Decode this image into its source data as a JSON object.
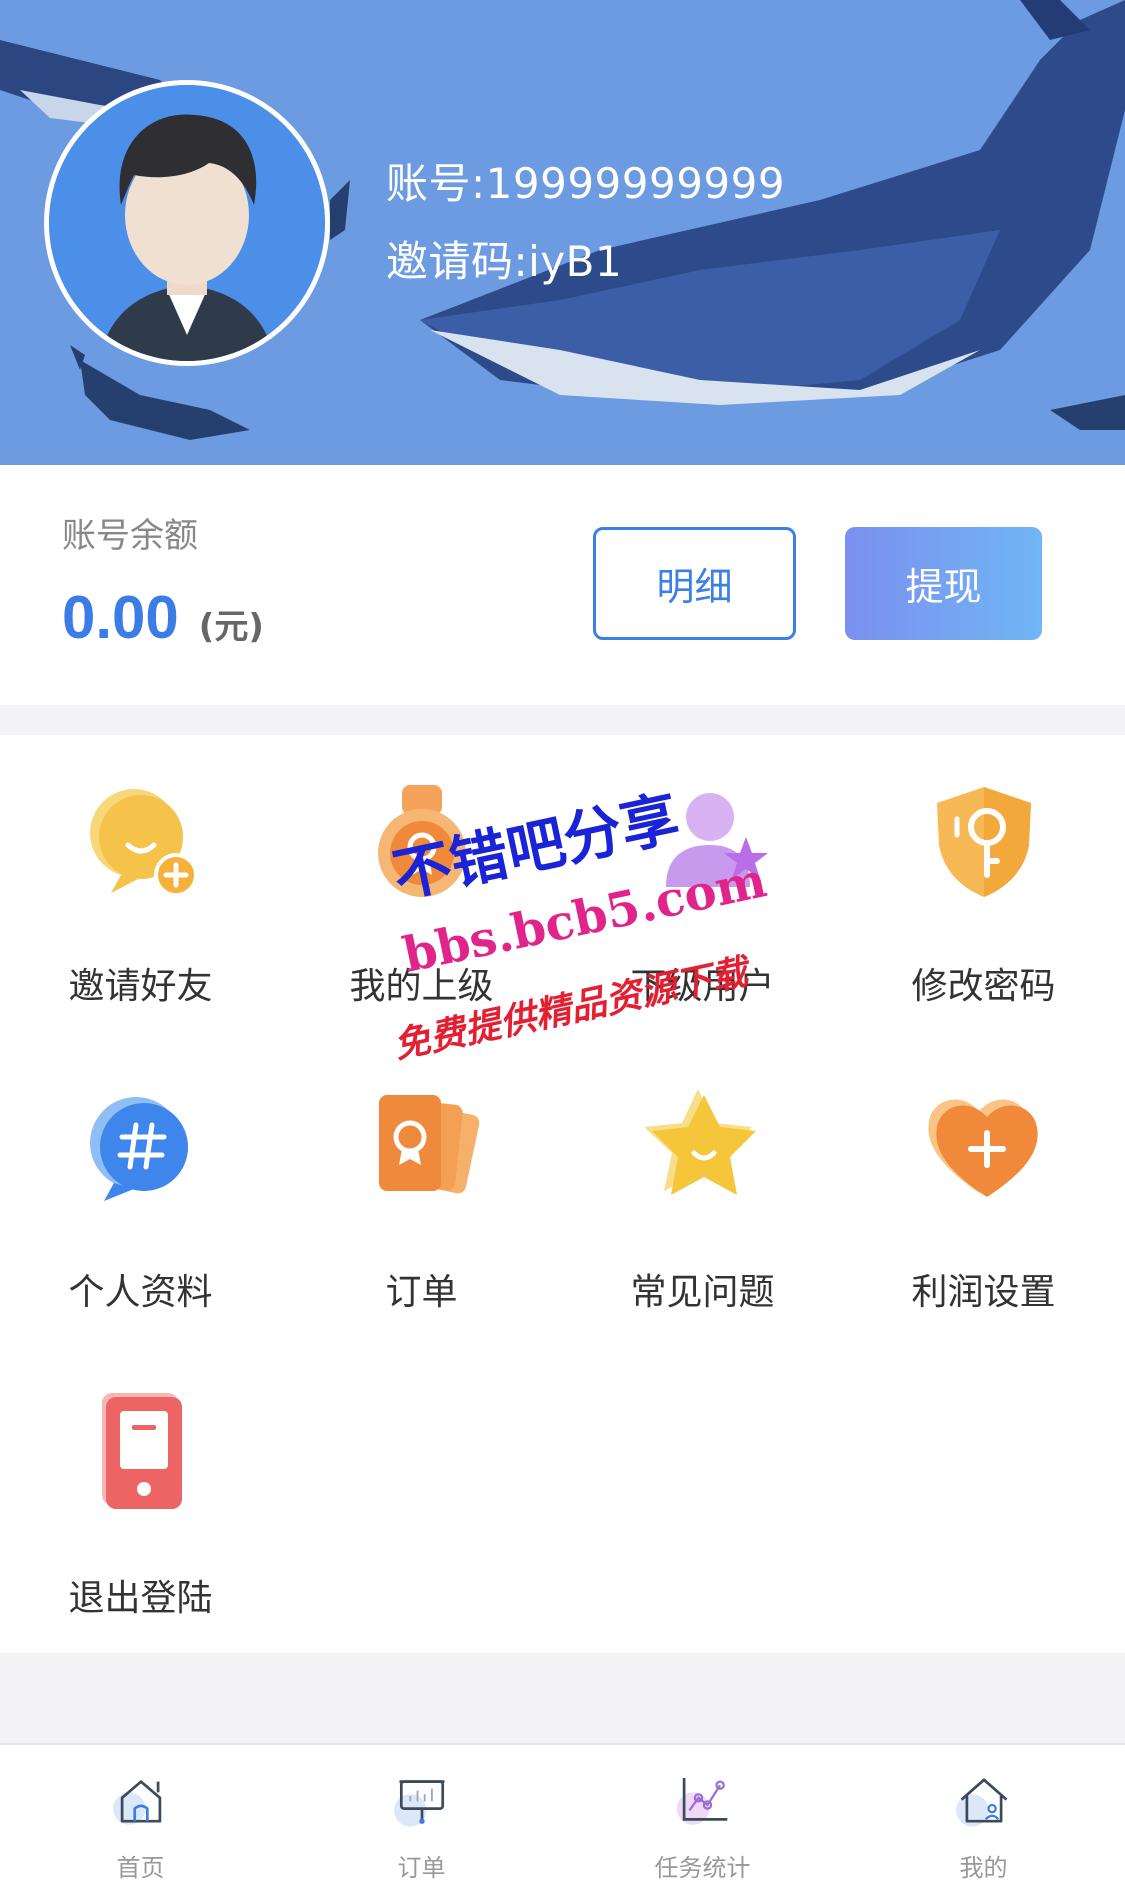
{
  "profile": {
    "account": "账号:19999999999",
    "invite_code": "邀请码:iyB1"
  },
  "balance": {
    "label": "账号余额",
    "amount": "0.00",
    "unit": "(元)",
    "detail_button": "明细",
    "withdraw_button": "提现"
  },
  "menu": {
    "items": [
      {
        "label": "邀请好友",
        "icon": "invite-friend-icon"
      },
      {
        "label": "我的上级",
        "icon": "medal-icon"
      },
      {
        "label": "下级用户",
        "icon": "subordinate-users-icon"
      },
      {
        "label": "修改密码",
        "icon": "key-shield-icon"
      },
      {
        "label": "个人资料",
        "icon": "hashtag-chat-icon"
      },
      {
        "label": "订单",
        "icon": "cards-icon"
      },
      {
        "label": "常见问题",
        "icon": "star-icon"
      },
      {
        "label": "利润设置",
        "icon": "heart-plus-icon"
      },
      {
        "label": "退出登陆",
        "icon": "phone-logout-icon"
      }
    ]
  },
  "watermark": {
    "line1": "不错吧分享",
    "line2": "bbs.bcb5.com",
    "line3": "免费提供精品资源下载"
  },
  "tabbar": {
    "tabs": [
      {
        "label": "首页",
        "icon": "home-icon"
      },
      {
        "label": "订单",
        "icon": "board-icon"
      },
      {
        "label": "任务统计",
        "icon": "chart-icon"
      },
      {
        "label": "我的",
        "icon": "user-home-icon"
      }
    ]
  },
  "colors": {
    "header_bg": "#6c9be2",
    "accent_blue": "#3b7ce6"
  }
}
